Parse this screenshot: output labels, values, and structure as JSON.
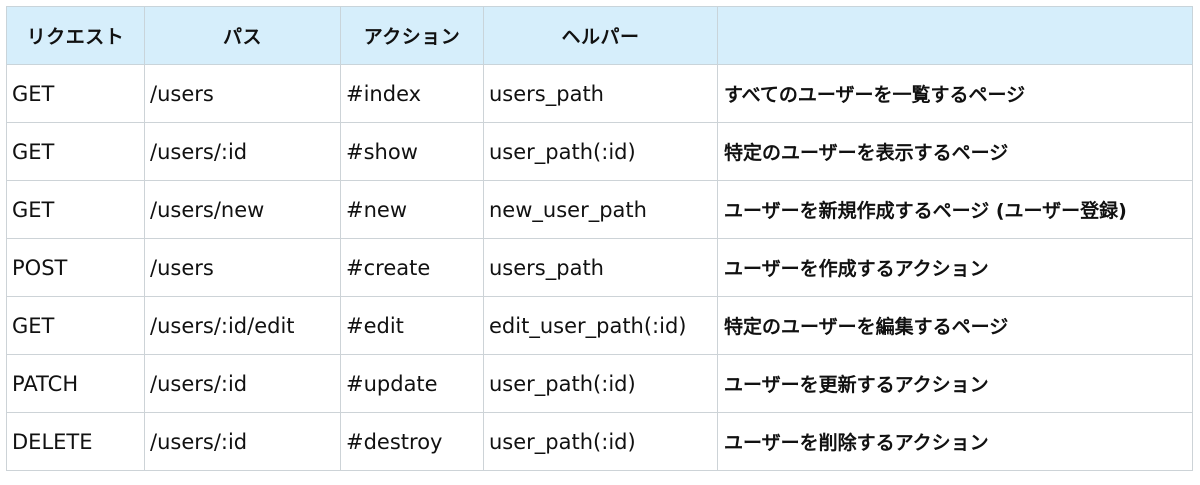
{
  "headers": [
    "リクエスト",
    "パス",
    "アクション",
    "ヘルパー",
    ""
  ],
  "rows": [
    {
      "request": "GET",
      "path": "/users",
      "action": "#index",
      "helper": "users_path",
      "description": "すべてのユーザーを一覧するページ"
    },
    {
      "request": "GET",
      "path": "/users/:id",
      "action": "#show",
      "helper": "user_path(:id)",
      "description": "特定のユーザーを表示するページ"
    },
    {
      "request": "GET",
      "path": "/users/new",
      "action": "#new",
      "helper": "new_user_path",
      "description": "ユーザーを新規作成するページ (ユーザー登録)"
    },
    {
      "request": "POST",
      "path": "/users",
      "action": "#create",
      "helper": "users_path",
      "description": "ユーザーを作成するアクション"
    },
    {
      "request": "GET",
      "path": "/users/:id/edit",
      "action": "#edit",
      "helper": "edit_user_path(:id)",
      "description": "特定のユーザーを編集するページ"
    },
    {
      "request": "PATCH",
      "path": "/users/:id",
      "action": "#update",
      "helper": "user_path(:id)",
      "description": "ユーザーを更新するアクション"
    },
    {
      "request": "DELETE",
      "path": "/users/:id",
      "action": "#destroy",
      "helper": "user_path(:id)",
      "description": "ユーザーを削除するアクション"
    }
  ]
}
